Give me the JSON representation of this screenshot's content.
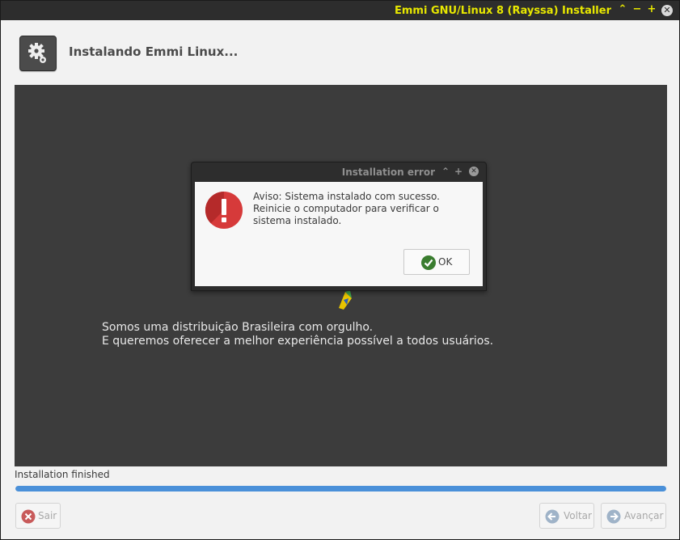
{
  "window": {
    "title": "Emmi GNU/Linux 8 (Rayssa) Installer",
    "accent_color": "#e8e800"
  },
  "header": {
    "title": "Instalando Emmi Linux...",
    "icon": "gear-icon"
  },
  "slide": {
    "line1": "Somos uma distribuição Brasileira com orgulho.",
    "line2": "E queremos oferecer a melhor experiência possível a todos usuários."
  },
  "dialog": {
    "title": "Installation error",
    "message": "Aviso: Sistema instalado com sucesso. Reinicie o computador para verificar o sistema instalado.",
    "ok_label": "OK",
    "icon": "error-icon"
  },
  "status": {
    "text": "Installation finished",
    "progress": 1.0,
    "progress_color": "#4a90d9"
  },
  "buttons": {
    "quit": "Sair",
    "back": "Voltar",
    "next": "Avançar"
  }
}
